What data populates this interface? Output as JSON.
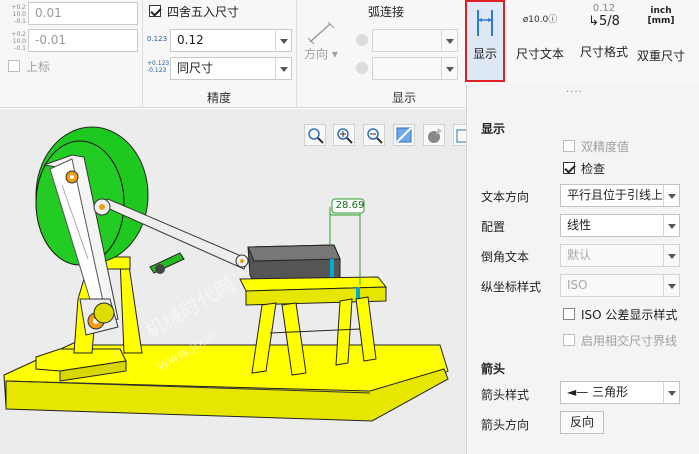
{
  "ribbon": {
    "upper_tol_value": "0.01",
    "lower_tol_value": "-0.01",
    "upper_label": "上标",
    "round_label": "四舍五入尺寸",
    "precision_value": "0.12",
    "tol_precision_value": "同尺寸",
    "precision_group": "精度",
    "direction_label": "方向",
    "arc_label": "弧连接",
    "display_group": "显示",
    "tol_icon_top": "+0.2",
    "tol_icon_mid": "10.0",
    "tol_icon_bot": "-0.1",
    "prec_icon": "0.123",
    "prec_icon2_top": "+0.123",
    "prec_icon2_bot": "-0.123",
    "buttons": {
      "display": "显示",
      "dim_text": "尺寸文本",
      "dim_text_icon": "ø10.0",
      "dim_format": "尺寸格式",
      "dim_format_top": "0.12",
      "dim_format_frac": "5/8",
      "dual": "双重尺寸",
      "dual_top": "inch",
      "dual_bot": "[mm]"
    },
    "overflow": "....",
    "display_icon_color": "#2e7bd6",
    "highlight_color": "#e02020"
  },
  "model": {
    "dimension_value": "28.69",
    "green_color": "#22cc22",
    "yellow_color": "#ffff00",
    "watermark_1": "机械时代网",
    "watermark_2": "www.jixie..."
  },
  "panel": {
    "display_section": "显示",
    "dual_precision": "双精度值",
    "inspect": "检查",
    "text_dir_label": "文本方向",
    "text_dir_value": "平行且位于引线上",
    "config_label": "配置",
    "config_value": "线性",
    "chamfer_label": "倒角文本",
    "chamfer_value": "默认",
    "ordinate_label": "纵坐标样式",
    "ordinate_value": "ISO",
    "iso_tol": "ISO 公差显示样式",
    "intersect": "启用相交尺寸界线",
    "arrow_section": "箭头",
    "arrow_style_label": "箭头样式",
    "arrow_style_value": "三角形",
    "arrow_dir_label": "箭头方向",
    "reverse_button": "反向"
  }
}
